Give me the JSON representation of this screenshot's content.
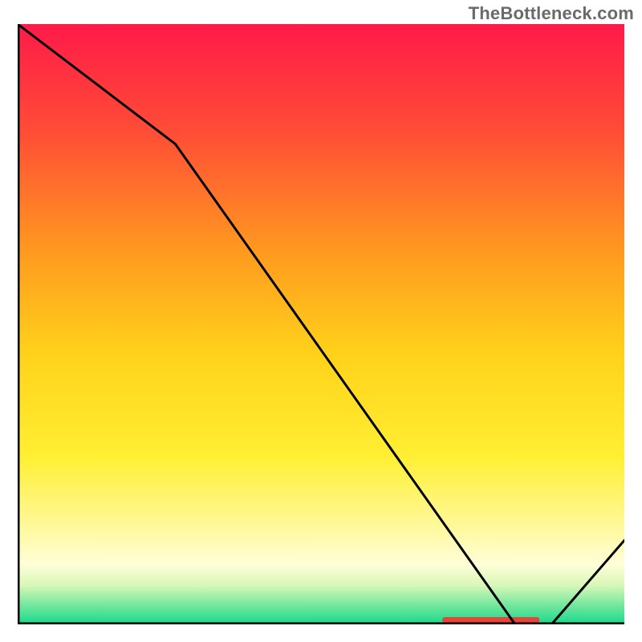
{
  "watermark": "TheBottleneck.com",
  "chart_data": {
    "type": "line",
    "title": "",
    "xlabel": "",
    "ylabel": "",
    "xlim": [
      0,
      100
    ],
    "ylim": [
      0,
      100
    ],
    "curve": {
      "name": "bottleneck-curve",
      "x": [
        0,
        26,
        82,
        88,
        100
      ],
      "y": [
        100,
        80,
        0,
        0,
        14
      ]
    },
    "highlight_band": {
      "name": "optimal-range-marker",
      "x_start": 70,
      "x_end": 86,
      "color": "#e8423b"
    },
    "gradient_stops": [
      {
        "offset": 0.0,
        "color": "#ff1a49"
      },
      {
        "offset": 0.18,
        "color": "#ff4d36"
      },
      {
        "offset": 0.38,
        "color": "#ff9a1f"
      },
      {
        "offset": 0.55,
        "color": "#ffd21a"
      },
      {
        "offset": 0.72,
        "color": "#ffef33"
      },
      {
        "offset": 0.84,
        "color": "#fff99e"
      },
      {
        "offset": 0.9,
        "color": "#fffed8"
      },
      {
        "offset": 0.935,
        "color": "#d9f7b8"
      },
      {
        "offset": 0.965,
        "color": "#7de8a0"
      },
      {
        "offset": 1.0,
        "color": "#17d98a"
      }
    ],
    "axis_color": "#000000",
    "curve_color": "#000000"
  }
}
